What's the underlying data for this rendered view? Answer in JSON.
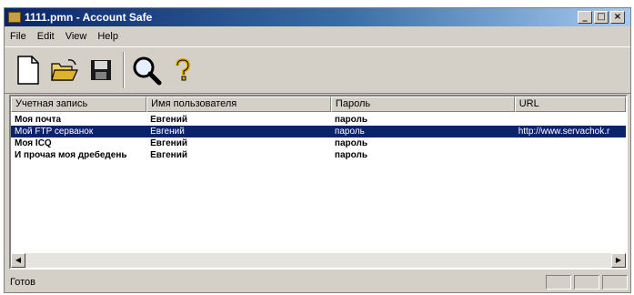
{
  "window": {
    "title": "1111.pmn - Account Safe"
  },
  "title_buttons": {
    "minimize": "_",
    "maximize": "□",
    "close": "×"
  },
  "menu": [
    "File",
    "Edit",
    "View",
    "Help"
  ],
  "toolbar": {
    "buttons": [
      {
        "icon": "new-document-icon"
      },
      {
        "icon": "open-folder-icon"
      },
      {
        "icon": "save-disk-icon"
      },
      {
        "icon": "search-magnifier-icon"
      },
      {
        "icon": "help-question-icon"
      }
    ]
  },
  "list": {
    "columns": [
      "Учетная запись",
      "Имя пользователя",
      "Пароль",
      "URL"
    ],
    "rows": [
      {
        "account": "Моя почта",
        "user": "Евгений",
        "password": "пароль",
        "url": "",
        "selected": false
      },
      {
        "account": "Мой FTP серванок",
        "user": "Евгений",
        "password": "пароль",
        "url": "http://www.servachok.r",
        "selected": true
      },
      {
        "account": "Моя ICQ",
        "user": "Евгений",
        "password": "пароль",
        "url": "",
        "selected": false
      },
      {
        "account": "И прочая моя дребедень",
        "user": "Евгений",
        "password": "пароль",
        "url": "",
        "selected": false
      }
    ]
  },
  "scrollbar": {
    "left_arrow": "◀",
    "right_arrow": "▶"
  },
  "status": {
    "text": "Готов"
  },
  "colors": {
    "title_active": "#0a246a",
    "selection": "#0a246a",
    "face": "#d4d0c8"
  }
}
